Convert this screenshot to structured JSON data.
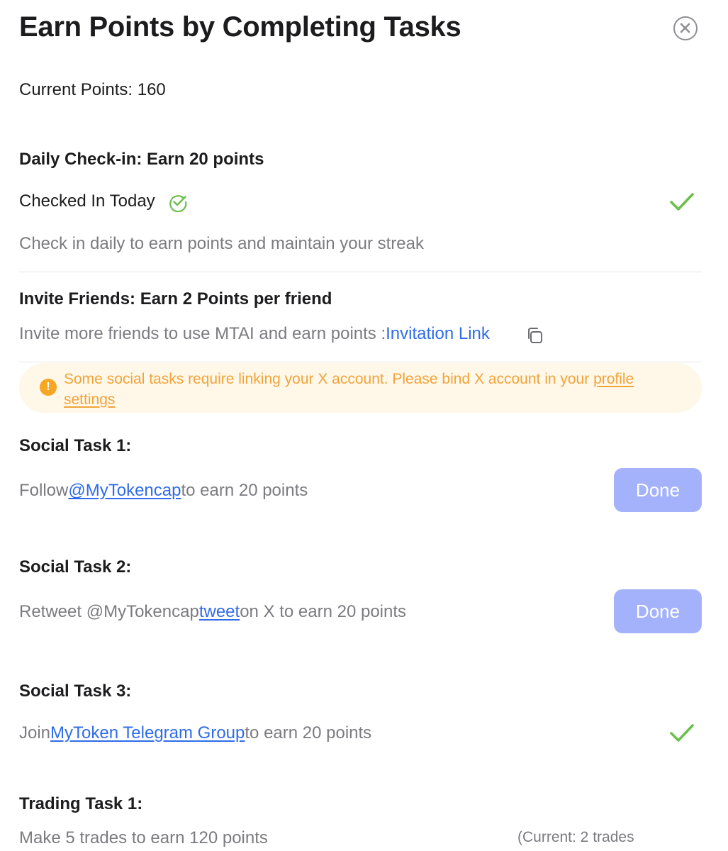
{
  "header": {
    "title": "Earn Points by Completing Tasks",
    "close_icon": "close-circle-icon"
  },
  "points": {
    "current_label": "Current Points: 160"
  },
  "daily": {
    "heading": "Daily Check-in: Earn 20 points",
    "status": "Checked In Today",
    "description": "Check in daily to earn points and maintain your streak"
  },
  "invite": {
    "heading": "Invite Friends: Earn 2 Points per friend",
    "text": "Invite more friends to use MTAI and earn points :",
    "link": "Invitation Link",
    "copy_icon": "copy-icon"
  },
  "notice": {
    "text": "Some social tasks require linking your X account. Please bind X account in your ",
    "link": "profile settings",
    "icon": "warning-icon"
  },
  "social1": {
    "heading": "Social Task 1:",
    "prefix": "Follow",
    "link": "@MyTokencap",
    "suffix": "to earn 20 points",
    "button": "Done"
  },
  "social2": {
    "heading": "Social Task 2:",
    "prefix": "Retweet @MyTokencap",
    "link": "tweet",
    "suffix": "on X to earn 20 points",
    "button": "Done"
  },
  "social3": {
    "heading": "Social Task 3:",
    "prefix": "Join",
    "link": "MyToken Telegram Group",
    "suffix": "to earn 20 points"
  },
  "trading1": {
    "heading": "Trading Task 1:",
    "text": "Make 5 trades to earn 120 points",
    "progress": "(Current: 2 trades"
  },
  "colors": {
    "accent": "#2f6bea",
    "success": "#6bc04b",
    "warning": "#f0a43a",
    "done_button": "#a4b2fb"
  }
}
